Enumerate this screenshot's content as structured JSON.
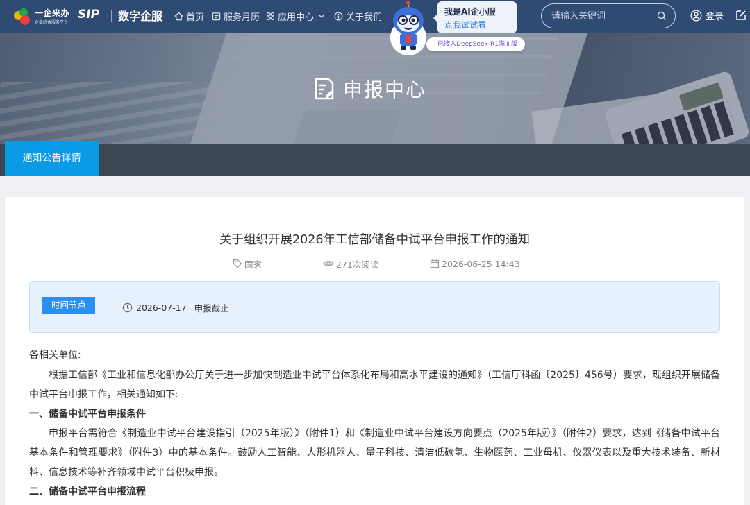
{
  "header": {
    "logo_yiqi": "一企来办",
    "logo_yiqi_sub": "企业综合服务平台",
    "logo_sip": "SIP",
    "logo_brand": "数字企服",
    "nav": [
      {
        "label": "首页",
        "icon": "home-icon"
      },
      {
        "label": "服务月历",
        "icon": "calendar-icon"
      },
      {
        "label": "应用中心",
        "icon": "apps-icon"
      },
      {
        "label": "关于我们",
        "icon": "info-icon"
      }
    ],
    "ai_title": "我是AI企小服",
    "ai_link": "点我试试看",
    "ai_badge": "已接入DeepSeek-R1满血版",
    "search_placeholder": "请输入关键词",
    "login_label": "登录"
  },
  "banner": {
    "title": "申报中心"
  },
  "tabs": {
    "active": "通知公告详情"
  },
  "article": {
    "title": "关于组织开展2026年工信部储备中试平台申报工作的通知",
    "tag": "国家",
    "views": "271次阅读",
    "date": "2026-06-25 14:43",
    "timenode": {
      "badge": "时间节点",
      "date": "2026-07-17",
      "label": "申报截止"
    },
    "salutation": "各相关单位:",
    "para1": "根据工信部《工业和信息化部办公厅关于进一步加快制造业中试平台体系化布局和高水平建设的通知》（工信厅科函〔2025〕456号）要求，现组织开展储备中试平台申报工作，相关通知如下:",
    "heading1": "一、储备中试平台申报条件",
    "para2": "申报平台需符合《制造业中试平台建设指引（2025年版）》（附件1）和《制造业中试平台建设方向要点（2025年版）》（附件2）要求，达到《储备中试平台基本条件和管理要求》（附件3）中的基本条件。鼓励人工智能、人形机器人、量子科技、清洁低碳氢、生物医药、工业母机、仪器仪表以及重大技术装备、新材料、信息技术等补齐领域中试平台积极申报。",
    "heading2": "二、储备中试平台申报流程"
  }
}
